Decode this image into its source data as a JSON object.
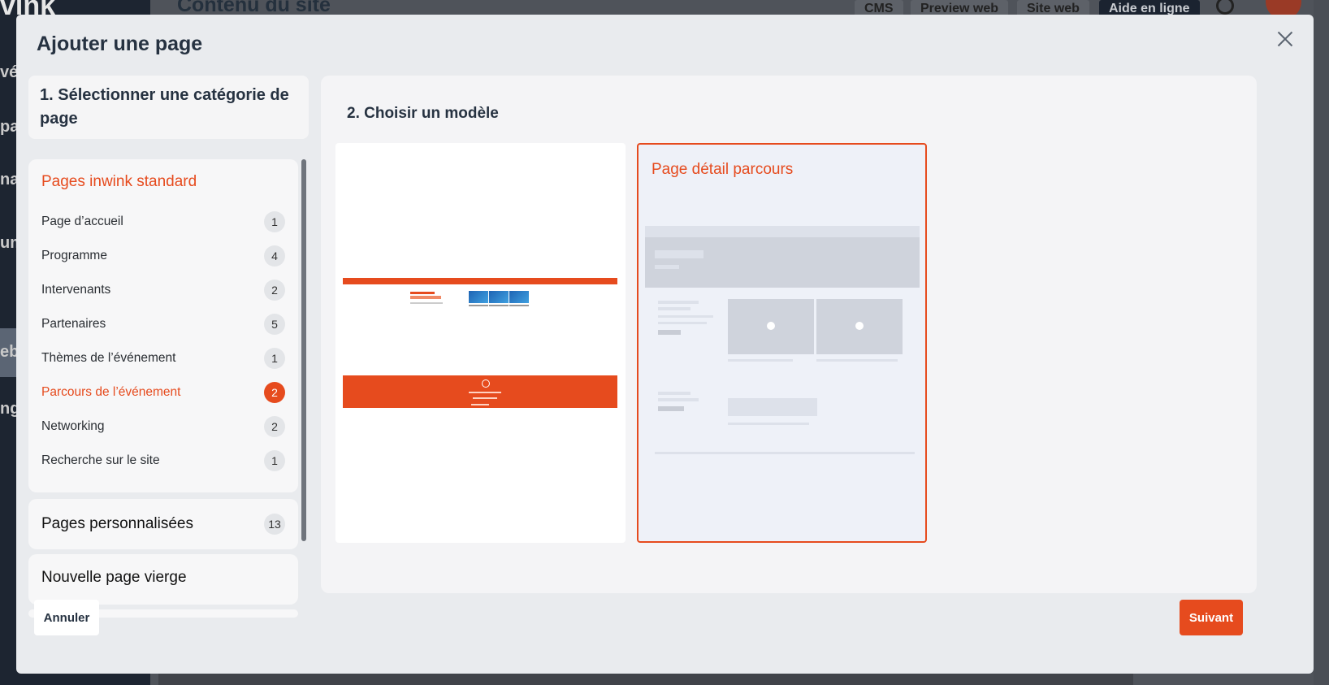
{
  "background": {
    "logo": "vink",
    "page_title": "Contenu du site",
    "top_buttons": [
      "CMS",
      "Preview web",
      "Site web",
      "Aide en ligne"
    ],
    "side_fragments": [
      "vé",
      "pa",
      "nai",
      "um",
      "eb",
      "ng"
    ]
  },
  "modal": {
    "title": "Ajouter une page",
    "step1": "1. Sélectionner une catégorie de page",
    "step2": "2. Choisir un modèle",
    "categories": {
      "standard": {
        "title": "Pages inwink standard",
        "items": [
          {
            "label": "Page d’accueil",
            "count": "1"
          },
          {
            "label": "Programme",
            "count": "4"
          },
          {
            "label": "Intervenants",
            "count": "2"
          },
          {
            "label": "Partenaires",
            "count": "5"
          },
          {
            "label": "Thèmes de l’événement",
            "count": "1"
          },
          {
            "label": "Parcours de l’événement",
            "count": "2"
          },
          {
            "label": "Networking",
            "count": "2"
          },
          {
            "label": "Recherche sur le site",
            "count": "1"
          }
        ]
      },
      "custom": {
        "title": "Pages personnalisées",
        "count": "13"
      },
      "blank": {
        "title": "Nouvelle page vierge"
      }
    },
    "templates": {
      "second_title": "Page détail parcours"
    },
    "buttons": {
      "cancel": "Annuler",
      "next": "Suivant"
    }
  },
  "colors": {
    "accent": "#e64b1e",
    "modal_bg": "#e9ebee",
    "text_dark": "#263241"
  }
}
